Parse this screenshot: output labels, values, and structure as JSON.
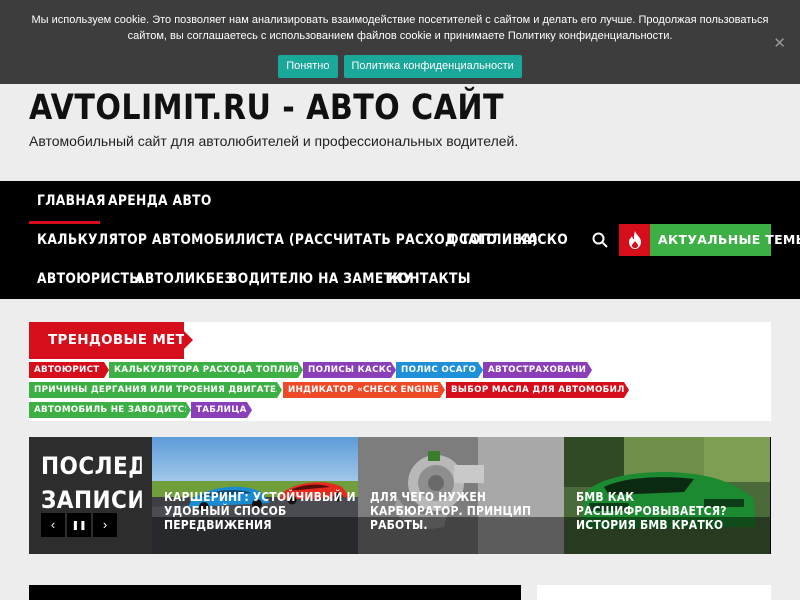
{
  "cookie": {
    "text": "Мы используем cookie. Это позволяет нам анализировать взаимодействие посетителей с сайтом и делать его лучше. Продолжая пользоваться сайтом, вы соглашаетесь с использованием файлов cookie и принимаете Политику конфиденциальности.",
    "accept_label": "Понятно",
    "policy_label": "Политика конфиденциальности",
    "close_glyph": "✕"
  },
  "site": {
    "title": "AVTOLIMIT.RU - АВТО САЙТ",
    "description": "Автомобильный сайт для автолюбителей и профессиональных водителей."
  },
  "nav": {
    "items": [
      "ГЛАВНАЯ",
      "АРЕНДА АВТО",
      "КАЛЬКУЛЯТОР АВТОМОБИЛИСТА (РАССЧИТАТЬ РАСХОД ТОПЛИВА)",
      "ОСАГО И КАСКО",
      "АВТОЮРИСТЫ",
      "АВТОЛИКБЕЗ",
      "ВОДИТЕЛЮ НА ЗАМЕТКУ",
      "КОНТАКТЫ"
    ],
    "active_index": 0,
    "hot_topics_label": "АКТУАЛЬНЫЕ ТЕМЫ",
    "icons": [
      "search-icon",
      "fire-icon"
    ]
  },
  "trending": {
    "heading": "ТРЕНДОВЫЕ МЕТКИ",
    "tags": [
      {
        "label": "АВТОЮРИСТ",
        "color": "#d60d1b"
      },
      {
        "label": "КАЛЬКУЛЯТОРА РАСХОДА ТОПЛИВА",
        "color": "#3db045"
      },
      {
        "label": "ПОЛИСЫ КАСКО",
        "color": "#8a3fb8"
      },
      {
        "label": "ПОЛИС ОСАГО",
        "color": "#1e8fd9"
      },
      {
        "label": "АВТОСТРАХОВАНИЕ",
        "color": "#8a3fb8"
      },
      {
        "label": "ПРИЧИНЫ ДЕРГАНИЯ ИЛИ ТРОЕНИЯ ДВИГАТЕЛЯ",
        "color": "#3db045"
      },
      {
        "label": "ИНДИКАТОР «CHECK ENGINE»",
        "color": "#ef4a28"
      },
      {
        "label": "ВЫБОР МАСЛА ДЛЯ АВТОМОБИЛЯ",
        "color": "#d60d1b"
      },
      {
        "label": "АВТОМОБИЛЬ НЕ ЗАВОДИТСЯ",
        "color": "#3db045"
      },
      {
        "label": "ТАБЛИЦА",
        "color": "#8a3fb8"
      }
    ]
  },
  "recent": {
    "heading": "ПОСЛЕДНИЕ ЗАПИСИ",
    "heading_line1": "ПОСЛЕДНИЕ",
    "heading_line2": "ЗАПИСИ",
    "controls": [
      "‹",
      "❚❚",
      "›"
    ],
    "posts": [
      {
        "title": "КАРШЕРИНГ: УСТОЙЧИВЫЙ И УДОБНЫЙ СПОСОБ ПЕРЕДВИЖЕНИЯ"
      },
      {
        "title": "ДЛЯ ЧЕГО НУЖЕН КАРБЮРАТОР. ПРИНЦИП РАБОТЫ."
      },
      {
        "title": "БМВ КАК РАСШИФРОВЫВАЕТСЯ? ИСТОРИЯ БМВ КРАТКО"
      }
    ]
  }
}
